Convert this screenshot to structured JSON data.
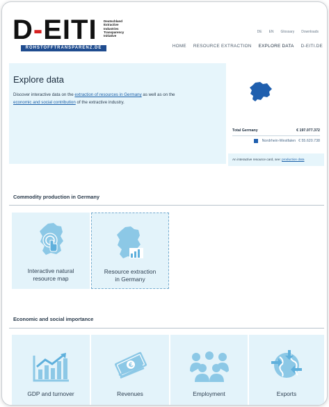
{
  "header": {
    "logo_text_left": "D",
    "logo_text_dash": "-",
    "logo_text_right": "EITI",
    "logo_small_lines": [
      "Deutschland",
      "Extractive",
      "Industries",
      "Transparency",
      "Initiative"
    ],
    "logo_bar": "ROHSTOFFTRANSPARENZ.DE",
    "utility_links": [
      "DE",
      "EN",
      "Glossary",
      "Downloads"
    ],
    "nav": [
      "HOME",
      "RESOURCE EXTRACTION",
      "EXPLORE DATA",
      "D-EITI.DE"
    ]
  },
  "explore": {
    "title": "Explore data",
    "text_1": "Discover interactive data on the ",
    "link_1": "extraction of resources in Germany",
    "text_2": " as well as on the ",
    "link_2": "economic and social contribution",
    "text_3": " of the extractive industry."
  },
  "map_panel": {
    "total_label": "Total Germany",
    "total_value": "€ 197.077.372",
    "region_label": "Nordrhein-Westfalen",
    "region_value": "€ 55.620.738",
    "note_text": "An interactive resource card, see: ",
    "note_link": "production data",
    "colors": {
      "region": "#1f5fae",
      "panel": "#e6f5fb"
    }
  },
  "commodity": {
    "title": "Commodity production in Germany",
    "tiles": [
      {
        "label_1": "Interactive natural",
        "label_2": "resource map",
        "icon": "germany-map-touch-icon"
      },
      {
        "label_1": "Resource extraction",
        "label_2": "in Germany",
        "icon": "germany-bar-chart-icon"
      }
    ]
  },
  "economic": {
    "title": "Economic and social importance",
    "tiles": [
      {
        "label": "GDP and turnover",
        "icon": "growth-chart-icon"
      },
      {
        "label": "Revenues",
        "icon": "money-bills-icon"
      },
      {
        "label": "Employment",
        "icon": "people-group-icon"
      },
      {
        "label": "Exports",
        "icon": "globe-arrows-icon"
      }
    ]
  }
}
